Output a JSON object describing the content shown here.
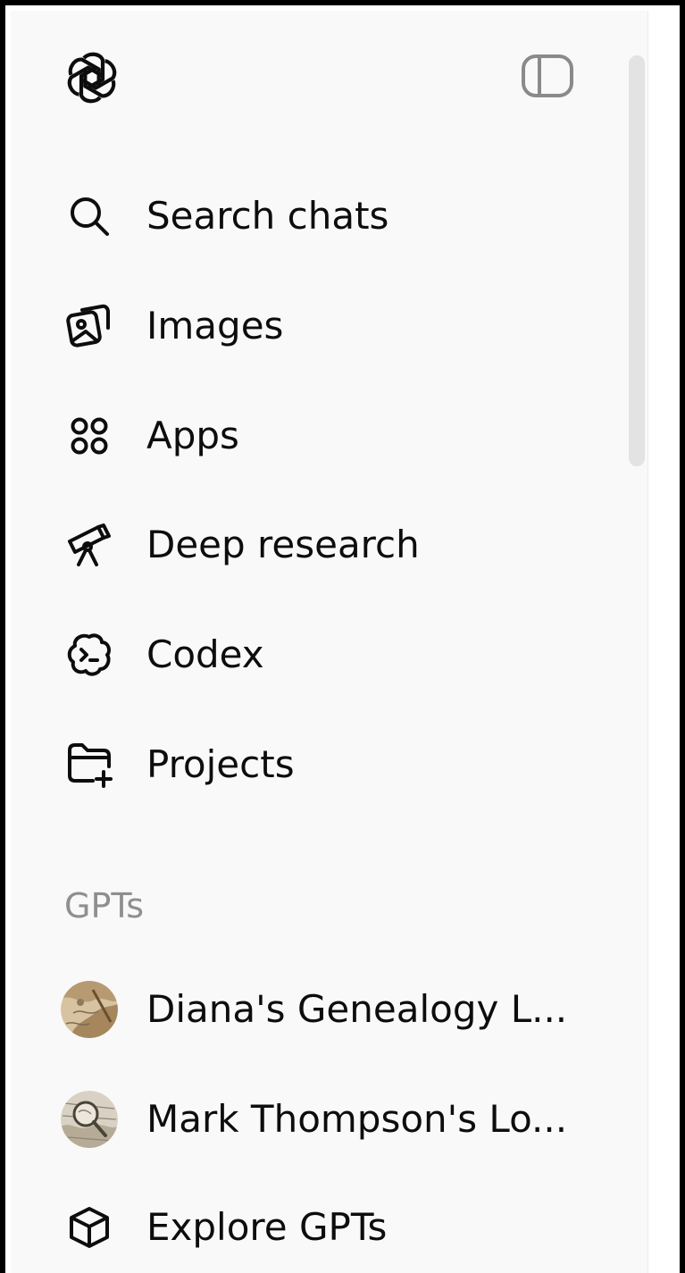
{
  "sidebar": {
    "logo_icon": "openai-logo-icon",
    "toggle_icon": "sidebar-toggle-icon",
    "nav_items": [
      {
        "label": "Search chats",
        "icon": "search-icon"
      },
      {
        "label": "Images",
        "icon": "images-icon"
      },
      {
        "label": "Apps",
        "icon": "apps-icon"
      },
      {
        "label": "Deep research",
        "icon": "telescope-icon"
      },
      {
        "label": "Codex",
        "icon": "codex-icon"
      },
      {
        "label": "Projects",
        "icon": "folder-plus-icon"
      }
    ],
    "gpts_section": {
      "heading": "GPTs",
      "items": [
        {
          "label": "Diana's Genealogy L...",
          "icon": "gpt-avatar-map"
        },
        {
          "label": "Mark Thompson's Lo...",
          "icon": "gpt-avatar-magnifier"
        },
        {
          "label": "Explore GPTs",
          "icon": "cube-icon"
        }
      ]
    }
  },
  "colors": {
    "sidebar_bg": "#f9f9f9",
    "text": "#0d0d0d",
    "muted_text": "#8f8f8f",
    "scrollbar": "#e3e3e3"
  }
}
